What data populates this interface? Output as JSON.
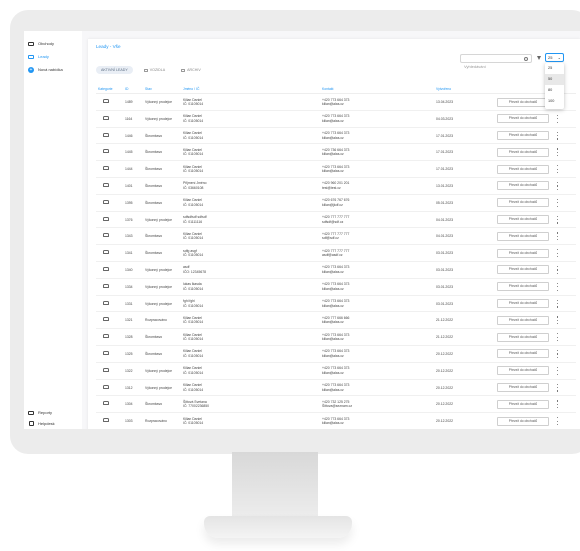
{
  "sidebar": {
    "items": [
      {
        "label": "Obchody",
        "icon": "briefcase-icon"
      },
      {
        "label": "Leady",
        "icon": "folder-icon"
      },
      {
        "label": "Nová nabídka",
        "icon": "plus-circle-icon"
      }
    ],
    "bottom": [
      {
        "label": "Reporty",
        "icon": "chart-icon"
      },
      {
        "label": "Helpdesk",
        "icon": "chat-icon"
      }
    ]
  },
  "main": {
    "title": "Leady - Vše",
    "search_placeholder": "Vyhledávání",
    "per_page": "25",
    "per_page_options": [
      "25",
      "50",
      "80",
      "100"
    ],
    "tabs": [
      "Aktivní leady",
      "Vozidla",
      "Archiv"
    ]
  },
  "table": {
    "headers": [
      "Kategorie",
      "ID",
      "Stav",
      "Jméno / IČ",
      "Kontakt",
      "Vytvořeno"
    ],
    "action_label": "Převzít do obchodů",
    "rows": [
      {
        "id": "1489",
        "stav": "Výkonný prodejce",
        "name": "Kilian Daniel",
        "ic": "IČ: 01105014",
        "phone": "+420 773 664 373",
        "email": "kilian@alas.cz",
        "date": "13.04.2023"
      },
      {
        "id": "1164",
        "stav": "Výkonný prodejce",
        "name": "Kilian Daniel",
        "ic": "IČ: 01105014",
        "phone": "+420 773 664 373",
        "email": "kilian@alas.cz",
        "date": "04.03.2023"
      },
      {
        "id": "1446",
        "stav": "Škrombavo",
        "name": "Kilian Daniel",
        "ic": "IČ: 01105014",
        "phone": "+420 773 664 373",
        "email": "kilian@alas.cz",
        "date": "17.01.2023"
      },
      {
        "id": "1445",
        "stav": "Škrombavo",
        "name": "Kilian Daniel",
        "ic": "IČ: 01105014",
        "phone": "+420 736 664 373",
        "email": "kilian@alas.cz",
        "date": "17.01.2023"
      },
      {
        "id": "1444",
        "stav": "Škrombavo",
        "name": "Kilian Daniel",
        "ic": "IČ: 01105014",
        "phone": "+420 773 664 373",
        "email": "kilian@alas.cz",
        "date": "17.01.2023"
      },
      {
        "id": "1401",
        "stav": "Škrombavo",
        "name": "Přijmení Jméno",
        "ic": "IČ: 03660108",
        "phone": "+420 960 201 201",
        "email": "test@test.cz",
        "date": "13.01.2023"
      },
      {
        "id": "1395",
        "stav": "Škrombavo",
        "name": "Kilian Daniel",
        "ic": "IČ: 01105014",
        "phone": "+420 676 767 676",
        "email": "kilian@jkdf.cz",
        "date": "05.01.2023"
      },
      {
        "id": "1376",
        "stav": "Výkonný prodejce",
        "name": "sdfsdfsdf sdfsdf",
        "ic": "IČ: 01111116",
        "phone": "+420 777 777 777",
        "email": "sdfsdf@sdf.cz",
        "date": "04.01.2023"
      },
      {
        "id": "1343",
        "stav": "Škrombavo",
        "name": "Kilian Daniel",
        "ic": "IČ: 01105014",
        "phone": "+420 777 777 777",
        "email": "sdf@sdf.cz",
        "date": "04.01.2023"
      },
      {
        "id": "1341",
        "stav": "Škrombavo",
        "name": "sdfg asgf",
        "ic": "IČ: 01105014",
        "phone": "+420 777 777 777",
        "email": "asdf@asdf.cz",
        "date": "03.01.2023"
      },
      {
        "id": "1340",
        "stav": "Výkonný prodejce",
        "name": "asdf",
        "ic": "IČO: 12345678",
        "phone": "+420 773 664 373",
        "email": "kilian@alas.cz",
        "date": "03.01.2023"
      },
      {
        "id": "1334",
        "stav": "Výkonný prodejce",
        "name": "lukas lkasda",
        "ic": "IČ: 01105014",
        "phone": "+420 773 664 373",
        "email": "kilian@alas.cz",
        "date": "03.01.2023"
      },
      {
        "id": "1331",
        "stav": "Výkonný prodejce",
        "name": "fghi fghi",
        "ic": "IČ: 01105014",
        "phone": "+420 773 664 373",
        "email": "kilian@alas.cz",
        "date": "03.01.2023"
      },
      {
        "id": "1321",
        "stav": "Rozpracováno",
        "name": "Kilian Daniel",
        "ic": "IČ: 01105014",
        "phone": "+420 777 666 666",
        "email": "kilian@alas.cz",
        "date": "21.12.2022"
      },
      {
        "id": "1328",
        "stav": "Škrombavo",
        "name": "Kilian Daniel",
        "ic": "IČ: 01105014",
        "phone": "+420 773 664 373",
        "email": "kilian@alas.cz",
        "date": "21.12.2022"
      },
      {
        "id": "1325",
        "stav": "Škrombavo",
        "name": "Kilian Daniel",
        "ic": "IČ: 01105014",
        "phone": "+420 773 664 373",
        "email": "kilian@alas.cz",
        "date": "20.12.2022"
      },
      {
        "id": "1322",
        "stav": "Výkonný prodejce",
        "name": "Kilian Daniel",
        "ic": "IČ: 01105014",
        "phone": "+420 773 664 373",
        "email": "kilian@alas.cz",
        "date": "20.12.2022"
      },
      {
        "id": "1312",
        "stav": "Výkonný prodejce",
        "name": "Kilian Daniel",
        "ic": "IČ: 01105014",
        "phone": "+420 773 664 373",
        "email": "kilian@alas.cz",
        "date": "20.12.2022"
      },
      {
        "id": "1304",
        "stav": "Škrombavo",
        "name": "Šittová Svetana",
        "ic": "IČ: 77002236850",
        "phone": "+420 732 125 275",
        "email": "Šittova@seznam.cz",
        "date": "20.12.2022"
      },
      {
        "id": "1303",
        "stav": "Rozpracováno",
        "name": "Kilian Daniel",
        "ic": "IČ: 01105014",
        "phone": "+420 773 664 373",
        "email": "kilian@alas.cz",
        "date": "20.12.2022"
      }
    ]
  }
}
